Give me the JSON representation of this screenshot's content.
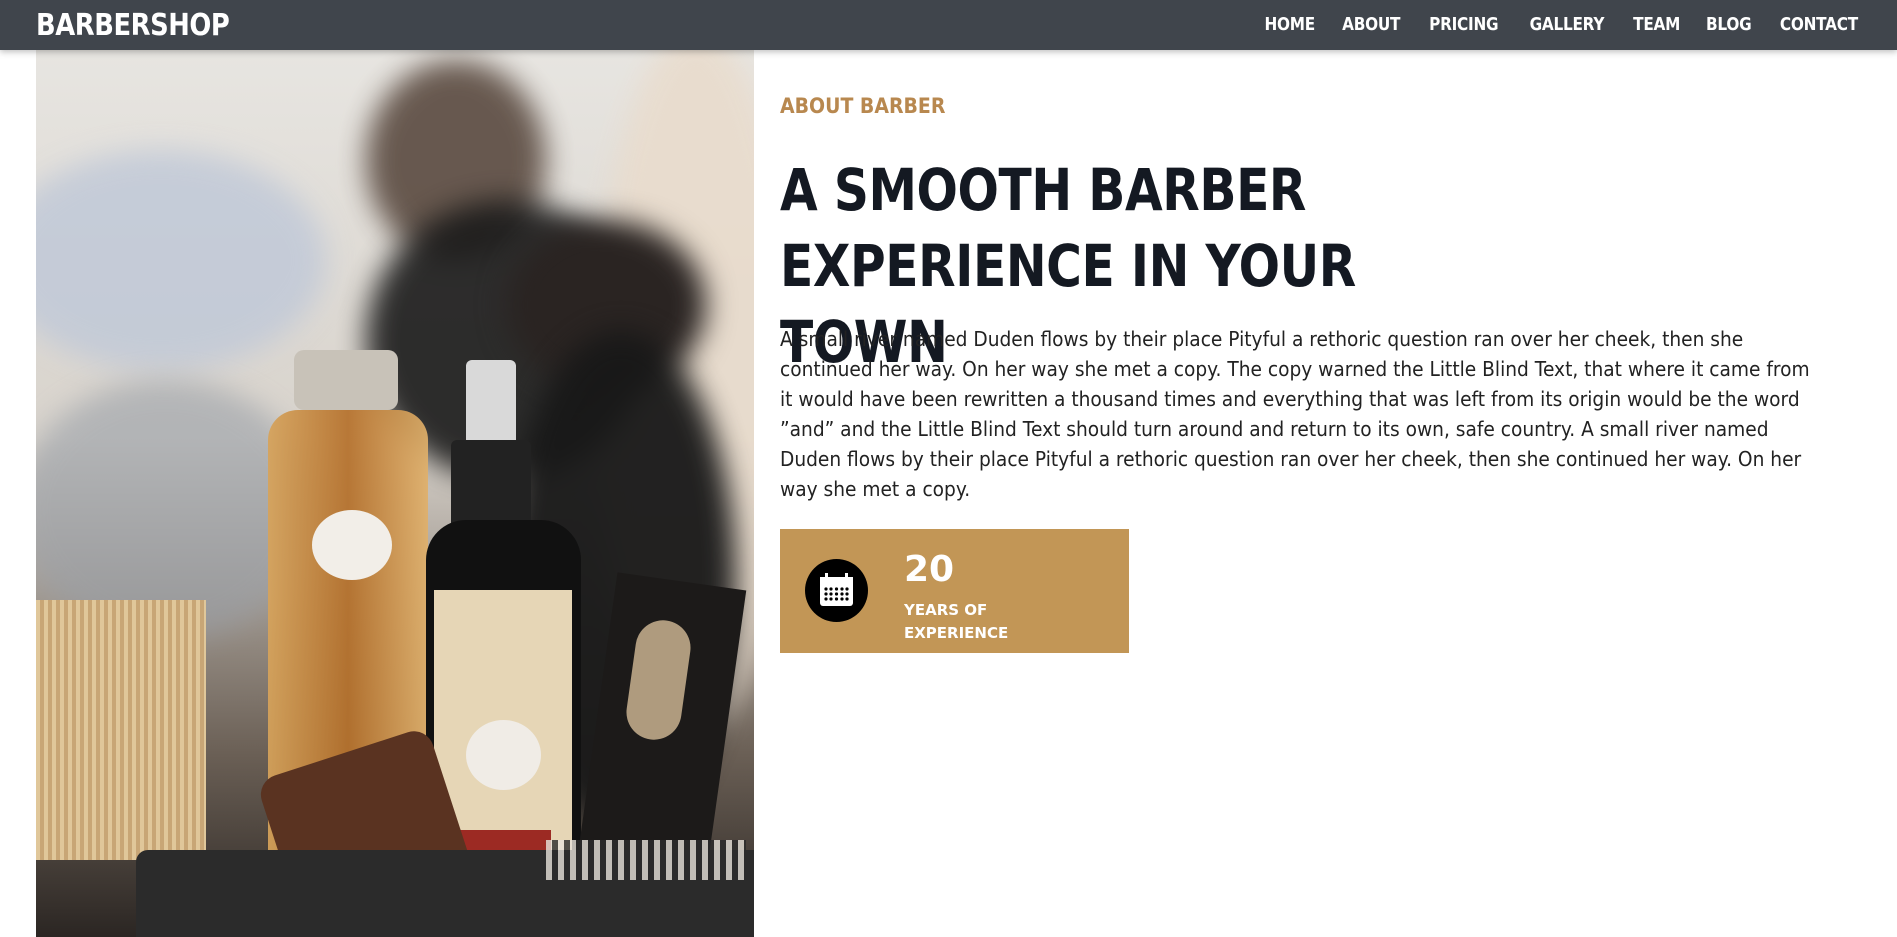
{
  "navbar": {
    "brand": "BARBERSHOP",
    "items": [
      {
        "label": "HOME"
      },
      {
        "label": "ABOUT"
      },
      {
        "label": "PRICING"
      },
      {
        "label": "GALLERY"
      },
      {
        "label": "TEAM"
      },
      {
        "label": "BLOG"
      },
      {
        "label": "CONTACT"
      }
    ]
  },
  "about": {
    "subtitle": "ABOUT BARBER",
    "heading_line1": "A SMOOTH BARBER",
    "heading_line2": "EXPERIENCE IN YOUR TOWN",
    "paragraph": "A small river named Duden flows by their place Pityful a rethoric question ran over her cheek, then she continued her way. On her way she met a copy. The copy warned the Little Blind Text, that where it came from it would have been rewritten a thousand times and everything that was left from its origin would be the word ”and” and the Little Blind Text should turn around and return to its own, safe country. A small river named Duden flows by their place Pityful a rethoric question ran over her cheek, then she continued her way. On her way she met a copy."
  },
  "stat": {
    "icon": "calendar-icon",
    "number": "20",
    "label_line1": "YEARS OF",
    "label_line2": "EXPERIENCE"
  },
  "colors": {
    "navbar_bg": "#40454c",
    "accent": "#c29656",
    "subtitle": "#b8884f",
    "heading": "#141922"
  }
}
